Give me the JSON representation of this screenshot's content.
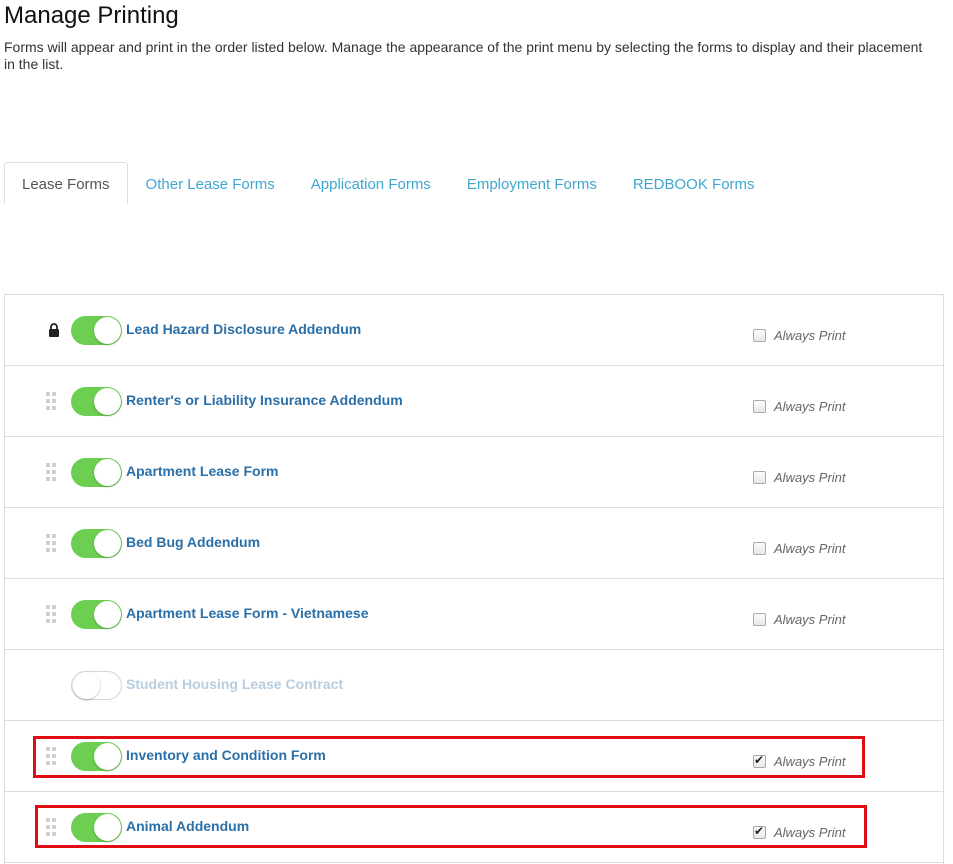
{
  "page": {
    "title": "Manage Printing",
    "description": "Forms will appear and print in the order listed below. Manage the appearance of the print menu by selecting the forms to display and their placement in the list."
  },
  "tabs": [
    {
      "label": "Lease Forms",
      "active": true
    },
    {
      "label": "Other Lease Forms",
      "active": false
    },
    {
      "label": "Application Forms",
      "active": false
    },
    {
      "label": "Employment Forms",
      "active": false
    },
    {
      "label": "REDBOOK Forms",
      "active": false
    }
  ],
  "always_print_label": "Always Print",
  "forms": [
    {
      "name": "Lead Hazard Disclosure Addendum",
      "handle": "lock-icon",
      "enabled": true,
      "always_print": false,
      "show_always_print": true,
      "highlighted": false
    },
    {
      "name": "Renter's or Liability Insurance Addendum",
      "handle": "drag-handle-icon",
      "enabled": true,
      "always_print": false,
      "show_always_print": true,
      "highlighted": false
    },
    {
      "name": "Apartment Lease Form",
      "handle": "drag-handle-icon",
      "enabled": true,
      "always_print": false,
      "show_always_print": true,
      "highlighted": false
    },
    {
      "name": "Bed Bug Addendum",
      "handle": "drag-handle-icon",
      "enabled": true,
      "always_print": false,
      "show_always_print": true,
      "highlighted": false
    },
    {
      "name": "Apartment Lease Form - Vietnamese",
      "handle": "drag-handle-icon",
      "enabled": true,
      "always_print": false,
      "show_always_print": true,
      "highlighted": false
    },
    {
      "name": "Student Housing Lease Contract",
      "handle": "none",
      "enabled": false,
      "always_print": false,
      "show_always_print": false,
      "highlighted": false
    },
    {
      "name": "Inventory and Condition Form",
      "handle": "drag-handle-icon",
      "enabled": true,
      "always_print": true,
      "show_always_print": true,
      "highlighted": true
    },
    {
      "name": "Animal Addendum",
      "handle": "drag-handle-icon",
      "enabled": true,
      "always_print": true,
      "show_always_print": true,
      "highlighted": true
    }
  ],
  "colors": {
    "toggle_on": "#6ccf51",
    "link": "#2a6fa8",
    "tab_link": "#3fa7cf",
    "highlight": "#e00d12"
  }
}
